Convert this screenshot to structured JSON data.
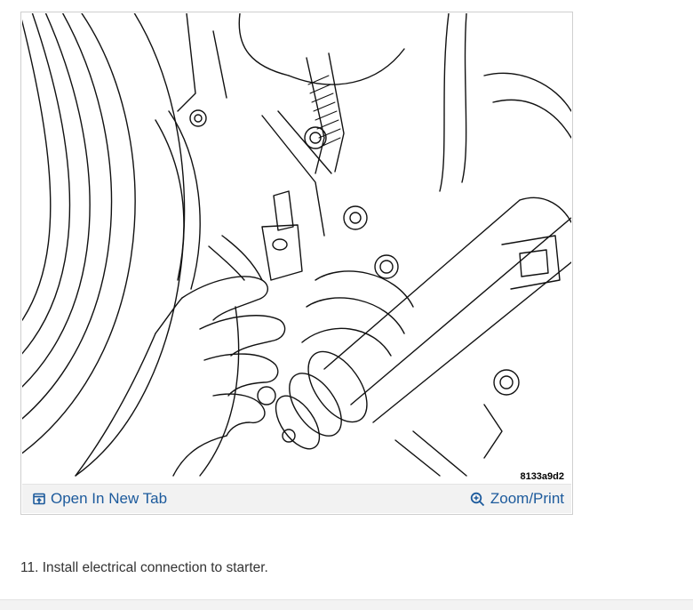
{
  "figure": {
    "image_alt": "Starter electrical connection illustration",
    "figure_id": "8133a9d2",
    "open_in_new_tab_label": "Open In New Tab",
    "zoom_print_label": "Zoom/Print",
    "icons": {
      "open_tab": "open-in-new-tab-icon",
      "zoom": "zoom-in-icon"
    },
    "link_color": "#1c5a9c"
  },
  "instruction": {
    "text": "11. Install electrical connection to starter."
  }
}
